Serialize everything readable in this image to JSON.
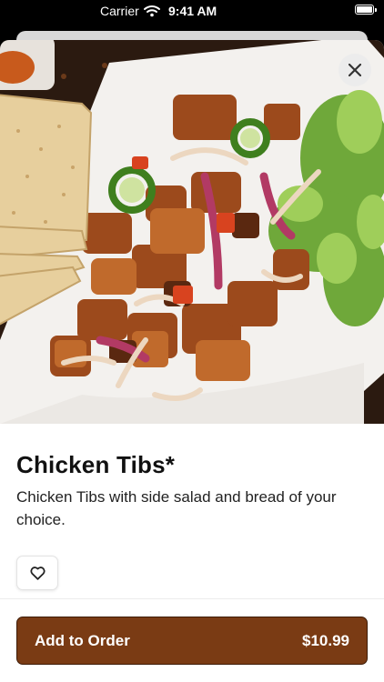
{
  "status_bar": {
    "carrier": "Carrier",
    "time": "9:41 AM"
  },
  "item": {
    "title": "Chicken Tibs*",
    "description": "Chicken Tibs with side salad and bread of your choice.",
    "image_subject": "Chicken tibs with sautéed onions, jalapeño slices and tomato, side salad and flatbread"
  },
  "actions": {
    "add_to_order_label": "Add to Order",
    "price": "$10.99"
  },
  "icons": {
    "close": "close-icon",
    "favorite": "heart-outline-icon",
    "wifi": "wifi-icon",
    "battery": "battery-icon"
  },
  "colors": {
    "accent": "#7a3b14",
    "accent_border": "#3d1c08"
  }
}
